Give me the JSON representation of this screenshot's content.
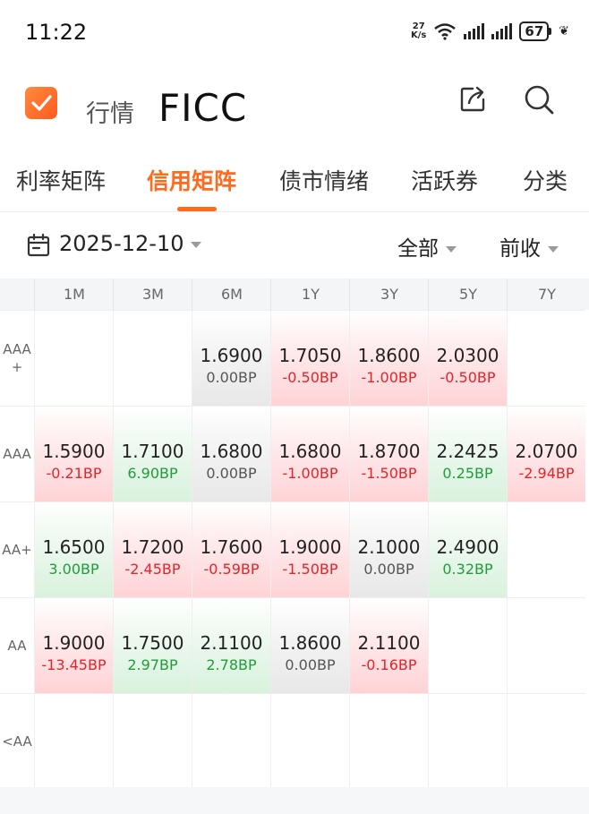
{
  "status": {
    "time": "11:22",
    "net_speed_value": "27",
    "net_speed_unit": "K/s",
    "battery": "67",
    "icons": [
      "wifi-icon",
      "signal-icon",
      "signal-icon",
      "battery-icon",
      "leaf-icon"
    ]
  },
  "header": {
    "subtitle": "行情",
    "title": "FICC",
    "icons": [
      "share-icon",
      "search-icon"
    ]
  },
  "tabs": [
    {
      "label": "利率矩阵",
      "active": false
    },
    {
      "label": "信用矩阵",
      "active": true
    },
    {
      "label": "债市情绪",
      "active": false
    },
    {
      "label": "活跃券",
      "active": false
    },
    {
      "label": "分类",
      "active": false
    }
  ],
  "filters": {
    "date": "2025-12-10",
    "scope": "全部",
    "compare": "前收"
  },
  "matrix": {
    "columns": [
      "1M",
      "3M",
      "6M",
      "1Y",
      "3Y",
      "5Y",
      "7Y"
    ],
    "rows": [
      {
        "label": "AAA+",
        "cells": [
          null,
          null,
          {
            "value": "1.6900",
            "change": "0.00BP",
            "trend": "flat"
          },
          {
            "value": "1.7050",
            "change": "-0.50BP",
            "trend": "down"
          },
          {
            "value": "1.8600",
            "change": "-1.00BP",
            "trend": "down"
          },
          {
            "value": "2.0300",
            "change": "-0.50BP",
            "trend": "down"
          },
          null
        ]
      },
      {
        "label": "AAA",
        "cells": [
          {
            "value": "1.5900",
            "change": "-0.21BP",
            "trend": "down"
          },
          {
            "value": "1.7100",
            "change": "6.90BP",
            "trend": "up"
          },
          {
            "value": "1.6800",
            "change": "0.00BP",
            "trend": "flat"
          },
          {
            "value": "1.6800",
            "change": "-1.00BP",
            "trend": "down"
          },
          {
            "value": "1.8700",
            "change": "-1.50BP",
            "trend": "down"
          },
          {
            "value": "2.2425",
            "change": "0.25BP",
            "trend": "up"
          },
          {
            "value": "2.0700",
            "change": "-2.94BP",
            "trend": "down"
          }
        ]
      },
      {
        "label": "AA+",
        "cells": [
          {
            "value": "1.6500",
            "change": "3.00BP",
            "trend": "up"
          },
          {
            "value": "1.7200",
            "change": "-2.45BP",
            "trend": "down"
          },
          {
            "value": "1.7600",
            "change": "-0.59BP",
            "trend": "down"
          },
          {
            "value": "1.9000",
            "change": "-1.50BP",
            "trend": "down"
          },
          {
            "value": "2.1000",
            "change": "0.00BP",
            "trend": "flat"
          },
          {
            "value": "2.4900",
            "change": "0.32BP",
            "trend": "up"
          },
          null
        ]
      },
      {
        "label": "AA",
        "cells": [
          {
            "value": "1.9000",
            "change": "-13.45BP",
            "trend": "down"
          },
          {
            "value": "1.7500",
            "change": "2.97BP",
            "trend": "up"
          },
          {
            "value": "2.1100",
            "change": "2.78BP",
            "trend": "up"
          },
          {
            "value": "1.8600",
            "change": "0.00BP",
            "trend": "flat"
          },
          {
            "value": "2.1100",
            "change": "-0.16BP",
            "trend": "down"
          },
          null,
          null
        ]
      },
      {
        "label": "<AA",
        "cells": [
          null,
          null,
          null,
          null,
          null,
          null,
          null
        ]
      }
    ]
  },
  "colors": {
    "accent": "#ff6a1f",
    "up": "#1f9d3a",
    "down": "#e0252c"
  }
}
